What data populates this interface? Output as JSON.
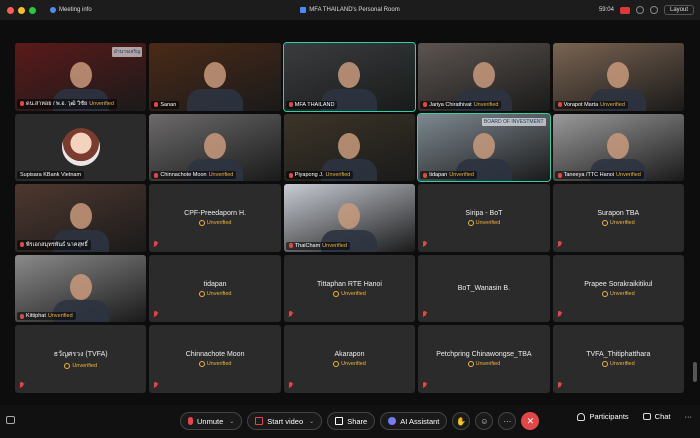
{
  "titlebar": {
    "meeting_info": "Meeting info",
    "room_title": "MFA THAILAND's Personal Room",
    "time": "59:04",
    "layout": "Layout"
  },
  "tiles": [
    {
      "label": "อำนาจเจริญ",
      "name": "ดน.สาหอย / พ.อ. วุฒิ วิชัย",
      "status": "Unverified",
      "kind": "video",
      "bg": "#5a1a1a"
    },
    {
      "label": "",
      "name": "Sanan",
      "status": "",
      "kind": "video",
      "bg": "#4a2a18"
    },
    {
      "label": "",
      "name": "MFA THAILAND",
      "status": "",
      "kind": "video",
      "bg": "#3a3c3e",
      "active": true
    },
    {
      "label": "",
      "name": "Jariya Chirathivat",
      "status": "Unverified",
      "kind": "video",
      "bg": "#5c5450"
    },
    {
      "label": "",
      "name": "Vorapot Marta",
      "status": "Unverified",
      "kind": "video",
      "bg": "#7a6452"
    },
    {
      "label": "",
      "name": "Supisara KBank Vietnam",
      "status": "",
      "kind": "avatar",
      "bg": "#2b2b2b"
    },
    {
      "label": "",
      "name": "Chinnachote Moon",
      "status": "Unverified",
      "kind": "video",
      "bg": "#6c6a6a"
    },
    {
      "label": "",
      "name": "Piyapong J.",
      "status": "Unverified",
      "kind": "video",
      "bg": "#3c3428"
    },
    {
      "label": "BOARD OF INVESTMENT",
      "name": "tidapan",
      "status": "Unverified",
      "kind": "video",
      "bg": "#7e8890",
      "active": true
    },
    {
      "label": "",
      "name": "Taneeya /TTC Hanoi",
      "status": "Unverified",
      "kind": "video",
      "bg": "#9a9a9a"
    },
    {
      "label": "",
      "name": "พีรเอกสมุทรพันธ์ นาคสุทธิ์",
      "status": "",
      "kind": "video",
      "bg": "#4e3830"
    },
    {
      "label": "",
      "name": "CPF-Preedaporn H.",
      "status": "Unverified",
      "kind": "name"
    },
    {
      "label": "",
      "name": "ThaiCham",
      "status": "Unverified",
      "kind": "video",
      "bg": "#c8ccd4"
    },
    {
      "label": "",
      "name": "Siripa - BoT",
      "status": "Unverified",
      "kind": "name"
    },
    {
      "label": "",
      "name": "Surapon TBA",
      "status": "Unverified",
      "kind": "name"
    },
    {
      "label": "",
      "name": "Kittiphat",
      "status": "Unverified",
      "kind": "video",
      "bg": "#8a8a8a"
    },
    {
      "label": "",
      "name": "tidapan",
      "status": "Unverified",
      "kind": "name"
    },
    {
      "label": "",
      "name": "Tittaphan RTE Hanoi",
      "status": "Unverified",
      "kind": "name"
    },
    {
      "label": "",
      "name": "BoT_Wanasin B.",
      "status": "",
      "kind": "name"
    },
    {
      "label": "",
      "name": "Prapee Sorakraikitikul",
      "status": "Unverified",
      "kind": "name"
    },
    {
      "label": "",
      "name": "ธวัญศรวง (TVFA)",
      "status": "Unverified",
      "kind": "name"
    },
    {
      "label": "",
      "name": "Chinnachote Moon",
      "status": "Unverified",
      "kind": "name"
    },
    {
      "label": "",
      "name": "Akarapon",
      "status": "Unverified",
      "kind": "name"
    },
    {
      "label": "",
      "name": "Petchpring Chinawongse_TBA",
      "status": "Unverified",
      "kind": "name"
    },
    {
      "label": "",
      "name": "TVFA_Thitiphatthara",
      "status": "Unverified",
      "kind": "name"
    }
  ],
  "toolbar": {
    "unmute": "Unmute",
    "start_video": "Start video",
    "share": "Share",
    "ai_assistant": "AI Assistant",
    "participants": "Participants",
    "chat": "Chat"
  },
  "colors": {
    "accent_active": "#2bd3a5",
    "unverified": "#f0b43c",
    "muted": "#e04848"
  }
}
